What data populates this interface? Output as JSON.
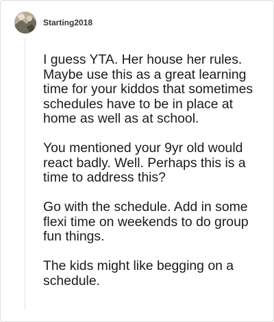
{
  "comment": {
    "author": "Starting2018",
    "avatar_icon": "user-avatar-photo",
    "paragraphs": [
      "I guess YTA. Her house her rules. Maybe use this as a great learning time for your kiddos that sometimes schedules have to be in place at home as well as at school.",
      "You mentioned your 9yr old would react badly. Well. Perhaps this is a time to address this?",
      "Go with the schedule. Add in some flexi time on weekends to do group fun things.",
      "The kids might like begging on a schedule."
    ]
  }
}
